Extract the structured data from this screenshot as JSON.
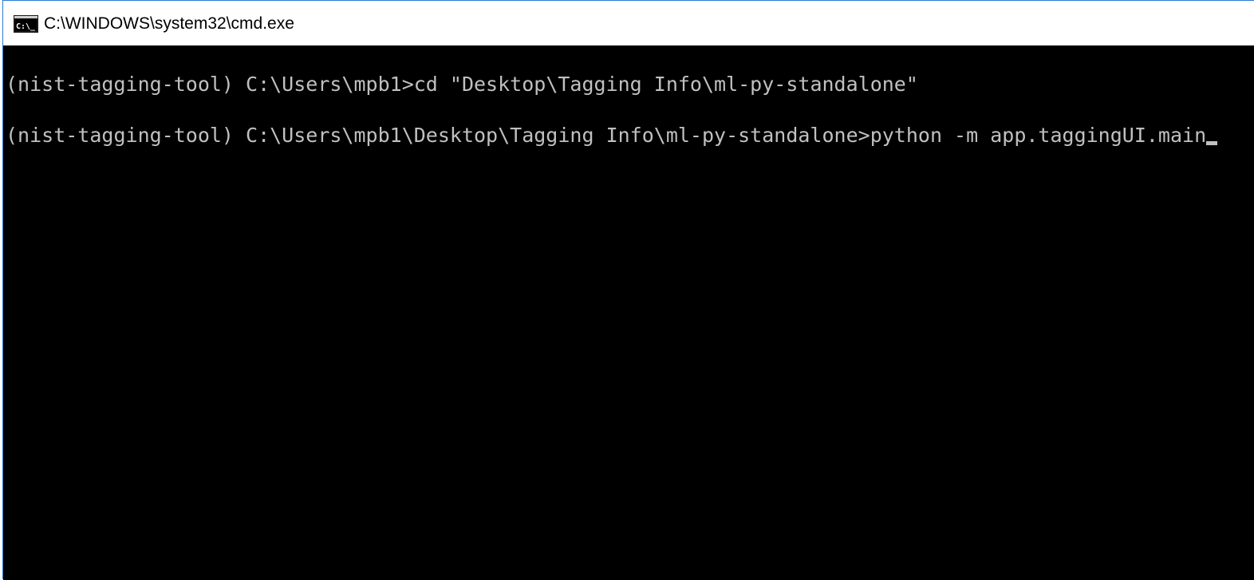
{
  "window": {
    "title": "C:\\WINDOWS\\system32\\cmd.exe",
    "icon": "cmd-icon"
  },
  "console": {
    "lines": [
      {
        "prompt": "(nist-tagging-tool) C:\\Users\\mpb1>",
        "command": "cd \"Desktop\\Tagging Info\\ml-py-standalone\""
      },
      {
        "prompt": "(nist-tagging-tool) C:\\Users\\mpb1\\Desktop\\Tagging Info\\ml-py-standalone>",
        "command": "python -m app.taggingUI.main"
      }
    ]
  },
  "colors": {
    "background": "#000000",
    "text": "#c0c0c0",
    "titlebar": "#ffffff",
    "border": "#2b79d6"
  }
}
